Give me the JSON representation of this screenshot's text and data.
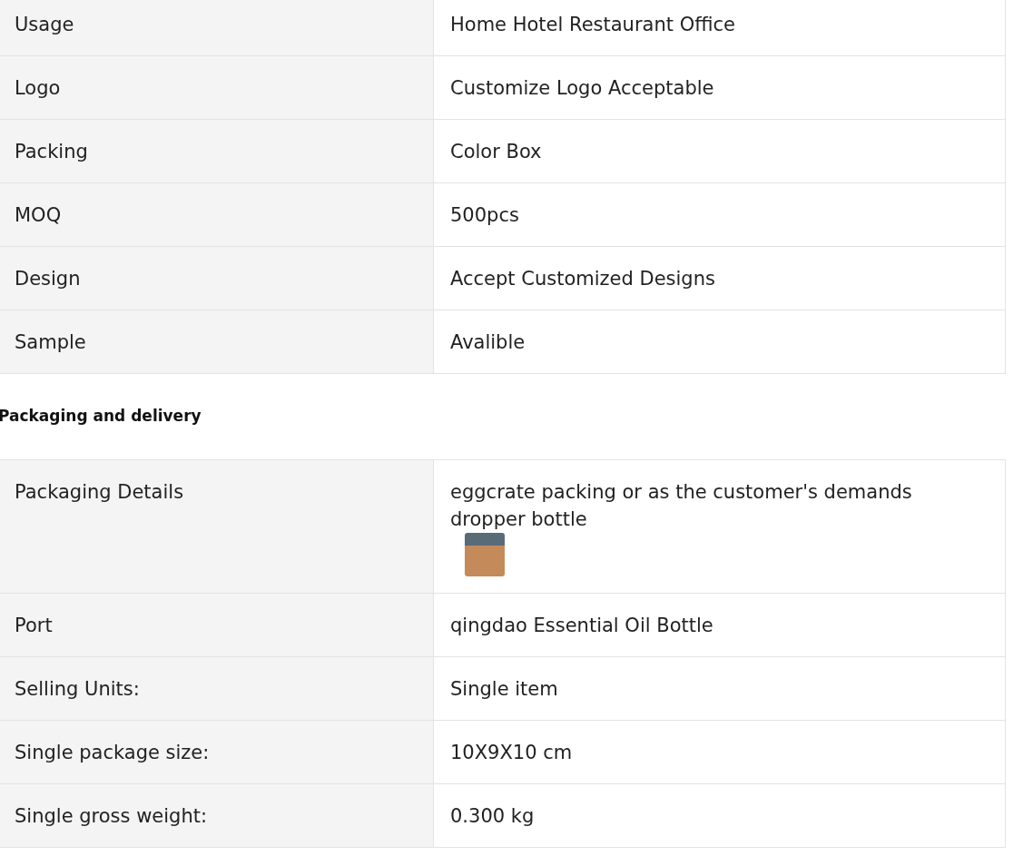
{
  "specifications": [
    {
      "label": "Usage",
      "value": "Home Hotel Restaurant Office"
    },
    {
      "label": "Logo",
      "value": "Customize Logo Acceptable"
    },
    {
      "label": "Packing",
      "value": "Color Box"
    },
    {
      "label": "MOQ",
      "value": "500pcs"
    },
    {
      "label": "Design",
      "value": "Accept Customized Designs"
    },
    {
      "label": "Sample",
      "value": "Avalible"
    }
  ],
  "packaging_heading": "Packaging and delivery",
  "packaging": [
    {
      "label": "Packaging Details",
      "value": "eggcrate packing or as the customer's demands dropper bottle",
      "image": true
    },
    {
      "label": "Port",
      "value": "qingdao Essential Oil Bottle"
    },
    {
      "label": "Selling Units:",
      "value": "Single item"
    },
    {
      "label": "Single package size:",
      "value": "10X9X10 cm"
    },
    {
      "label": "Single gross weight:",
      "value": "0.300 kg"
    }
  ]
}
